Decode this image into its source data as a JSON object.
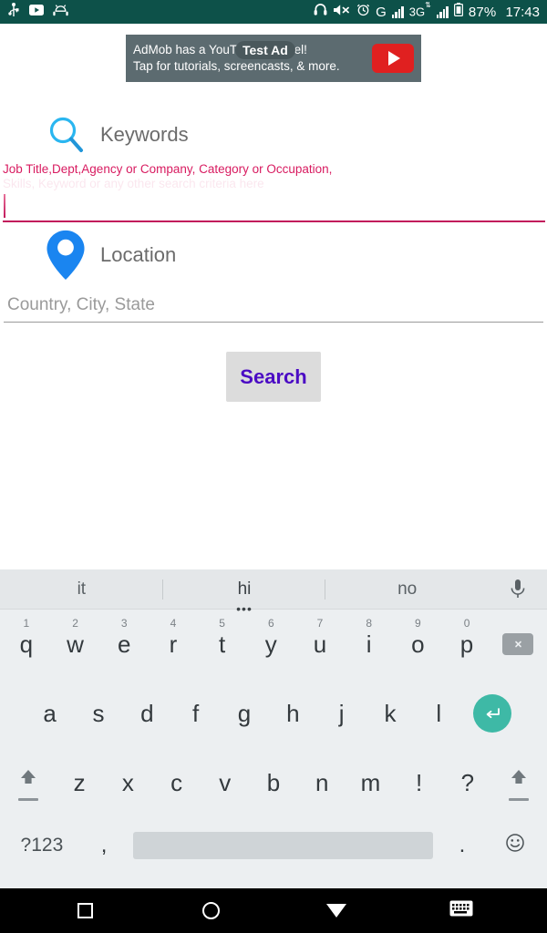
{
  "statusbar": {
    "left_icons": [
      "usb-icon",
      "youtube-icon",
      "android-robot-icon"
    ],
    "right_icons": [
      "headset-icon",
      "volume-mute-icon",
      "alarm-icon"
    ],
    "gprs_label": "G",
    "network_label": "3G",
    "battery_percent": "87%",
    "time": "17:43",
    "background": "#0d5149",
    "foreground": "#ffffff"
  },
  "ad": {
    "badge": "Test Ad",
    "line1": "AdMob has a YouTube channel!",
    "line2": "Tap for tutorials, screencasts, & more.",
    "play_icon": "youtube-play-icon",
    "background": "#5c6b70",
    "play_color": "#e02020"
  },
  "form": {
    "keywords": {
      "icon": "magnifier-icon",
      "icon_color": "#29b6f6",
      "label": "Keywords",
      "hint": "Job Title,Dept,Agency or Company, Category or Occupation,",
      "hint_second_line": "Skills, Keyword or any other search criteria here",
      "hint_color": "#d81b60",
      "value": "",
      "underline_color": "#c2185b",
      "focused": true
    },
    "location": {
      "icon": "map-pin-icon",
      "icon_color": "#1a85f0",
      "label": "Location",
      "placeholder": "Country, City, State",
      "value": "",
      "underline_color": "#9a9a9a"
    },
    "search_button": {
      "label": "Search",
      "text_color": "#4b0bc4",
      "background": "#dcdcdc"
    }
  },
  "keyboard": {
    "suggestions": [
      {
        "text": "it",
        "selected": false
      },
      {
        "text": "hi",
        "selected": true
      },
      {
        "text": "no",
        "selected": false
      }
    ],
    "mic_icon": "microphone-icon",
    "row1": [
      {
        "key": "q",
        "num": "1"
      },
      {
        "key": "w",
        "num": "2"
      },
      {
        "key": "e",
        "num": "3"
      },
      {
        "key": "r",
        "num": "4"
      },
      {
        "key": "t",
        "num": "5"
      },
      {
        "key": "y",
        "num": "6"
      },
      {
        "key": "u",
        "num": "7"
      },
      {
        "key": "i",
        "num": "8"
      },
      {
        "key": "o",
        "num": "9"
      },
      {
        "key": "p",
        "num": "0"
      }
    ],
    "backspace_icon": "backspace-icon",
    "row2": [
      "a",
      "s",
      "d",
      "f",
      "g",
      "h",
      "j",
      "k",
      "l"
    ],
    "enter_icon": "enter-arrow-icon",
    "enter_color": "#3eb9a6",
    "row3": [
      "z",
      "x",
      "c",
      "v",
      "b",
      "n",
      "m",
      "!",
      "?"
    ],
    "shift_icon": "shift-arrow-icon",
    "symbols_key": "?123",
    "comma_key": ",",
    "period_key": ".",
    "space_key": "",
    "emoji_icon": "emoji-smiley-icon",
    "background": "#eceff1"
  },
  "navbar": {
    "recents": "recents-square-icon",
    "home": "home-circle-icon",
    "back": "back-triangle-icon",
    "keyboard_switch": "keyboard-switch-icon",
    "background": "#000000"
  }
}
